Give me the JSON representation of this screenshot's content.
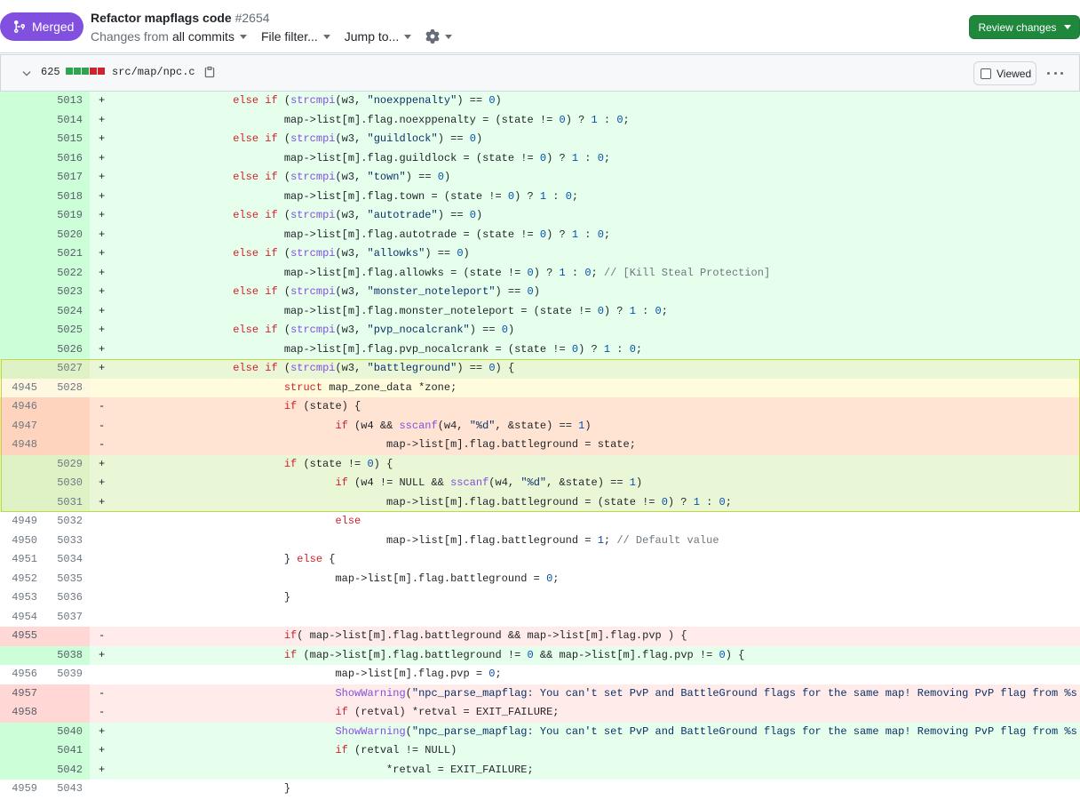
{
  "pr": {
    "state_label": "Merged",
    "title": "Refactor mapflags code",
    "number": "#2654",
    "changes_prefix": "Changes from",
    "changes_value": "all commits",
    "file_filter": "File filter...",
    "jump_to": "Jump to...",
    "review_button": "Review changes"
  },
  "file": {
    "change_count": "625",
    "path": "src/map/npc.c",
    "viewed_label": "Viewed",
    "diffstat": [
      "add",
      "add",
      "add",
      "del",
      "del"
    ]
  },
  "colors": {
    "merged": "#8250df",
    "review": "#1f883d",
    "add": "#e6ffec",
    "del": "#ffebe9"
  },
  "diff": [
    {
      "t": "add",
      "o": "",
      "n": "5013",
      "s": "+",
      "c": "\t\t\t\telse if (strcmpi(w3, \"noexppenalty\") == 0)"
    },
    {
      "t": "add",
      "o": "",
      "n": "5014",
      "s": "+",
      "c": "\t\t\t\t\t\tmap->list[m].flag.noexppenalty = (state != 0) ? 1 : 0;"
    },
    {
      "t": "add",
      "o": "",
      "n": "5015",
      "s": "+",
      "c": "\t\t\t\telse if (strcmpi(w3, \"guildlock\") == 0)"
    },
    {
      "t": "add",
      "o": "",
      "n": "5016",
      "s": "+",
      "c": "\t\t\t\t\t\tmap->list[m].flag.guildlock = (state != 0) ? 1 : 0;"
    },
    {
      "t": "add",
      "o": "",
      "n": "5017",
      "s": "+",
      "c": "\t\t\t\telse if (strcmpi(w3, \"town\") == 0)"
    },
    {
      "t": "add",
      "o": "",
      "n": "5018",
      "s": "+",
      "c": "\t\t\t\t\t\tmap->list[m].flag.town = (state != 0) ? 1 : 0;"
    },
    {
      "t": "add",
      "o": "",
      "n": "5019",
      "s": "+",
      "c": "\t\t\t\telse if (strcmpi(w3, \"autotrade\") == 0)"
    },
    {
      "t": "add",
      "o": "",
      "n": "5020",
      "s": "+",
      "c": "\t\t\t\t\t\tmap->list[m].flag.autotrade = (state != 0) ? 1 : 0;"
    },
    {
      "t": "add",
      "o": "",
      "n": "5021",
      "s": "+",
      "c": "\t\t\t\telse if (strcmpi(w3, \"allowks\") == 0)"
    },
    {
      "t": "add",
      "o": "",
      "n": "5022",
      "s": "+",
      "c": "\t\t\t\t\t\tmap->list[m].flag.allowks = (state != 0) ? 1 : 0; // [Kill Steal Protection]"
    },
    {
      "t": "add",
      "o": "",
      "n": "5023",
      "s": "+",
      "c": "\t\t\t\telse if (strcmpi(w3, \"monster_noteleport\") == 0)"
    },
    {
      "t": "add",
      "o": "",
      "n": "5024",
      "s": "+",
      "c": "\t\t\t\t\t\tmap->list[m].flag.monster_noteleport = (state != 0) ? 1 : 0;"
    },
    {
      "t": "add",
      "o": "",
      "n": "5025",
      "s": "+",
      "c": "\t\t\t\telse if (strcmpi(w3, \"pvp_nocalcrank\") == 0)"
    },
    {
      "t": "add",
      "o": "",
      "n": "5026",
      "s": "+",
      "c": "\t\t\t\t\t\tmap->list[m].flag.pvp_nocalcrank = (state != 0) ? 1 : 0;"
    },
    {
      "t": "sel-add",
      "o": "",
      "n": "5027",
      "s": "+",
      "c": "\t\t\t\telse if (strcmpi(w3, \"battleground\") == 0) {"
    },
    {
      "t": "sel-ctx",
      "o": "4945",
      "n": "5028",
      "s": "",
      "c": "\t\t\t\t\t\tstruct map_zone_data *zone;"
    },
    {
      "t": "sel-del",
      "o": "4946",
      "n": "",
      "s": "-",
      "c": "\t\t\t\t\t\tif (state) {"
    },
    {
      "t": "sel-del",
      "o": "4947",
      "n": "",
      "s": "-",
      "c": "\t\t\t\t\t\t\t\tif (w4 && sscanf(w4, \"%d\", &state) == 1)"
    },
    {
      "t": "sel-del",
      "o": "4948",
      "n": "",
      "s": "-",
      "c": "\t\t\t\t\t\t\t\t\t\tmap->list[m].flag.battleground = state;"
    },
    {
      "t": "sel-add",
      "o": "",
      "n": "5029",
      "s": "+",
      "c": "\t\t\t\t\t\tif (state != 0) {"
    },
    {
      "t": "sel-add",
      "o": "",
      "n": "5030",
      "s": "+",
      "c": "\t\t\t\t\t\t\t\tif (w4 != NULL && sscanf(w4, \"%d\", &state) == 1)"
    },
    {
      "t": "sel-add",
      "o": "",
      "n": "5031",
      "s": "+",
      "c": "\t\t\t\t\t\t\t\t\t\tmap->list[m].flag.battleground = (state != 0) ? 1 : 0;"
    },
    {
      "t": "ctx",
      "o": "4949",
      "n": "5032",
      "s": "",
      "c": "\t\t\t\t\t\t\t\telse"
    },
    {
      "t": "ctx",
      "o": "4950",
      "n": "5033",
      "s": "",
      "c": "\t\t\t\t\t\t\t\t\t\tmap->list[m].flag.battleground = 1; // Default value"
    },
    {
      "t": "ctx",
      "o": "4951",
      "n": "5034",
      "s": "",
      "c": "\t\t\t\t\t\t} else {"
    },
    {
      "t": "ctx",
      "o": "4952",
      "n": "5035",
      "s": "",
      "c": "\t\t\t\t\t\t\t\tmap->list[m].flag.battleground = 0;"
    },
    {
      "t": "ctx",
      "o": "4953",
      "n": "5036",
      "s": "",
      "c": "\t\t\t\t\t\t}"
    },
    {
      "t": "ctx",
      "o": "4954",
      "n": "5037",
      "s": "",
      "c": ""
    },
    {
      "t": "del",
      "o": "4955",
      "n": "",
      "s": "-",
      "c": "\t\t\t\t\t\tif( map->list[m].flag.battleground && map->list[m].flag.pvp ) {"
    },
    {
      "t": "add",
      "o": "",
      "n": "5038",
      "s": "+",
      "c": "\t\t\t\t\t\tif (map->list[m].flag.battleground != 0 && map->list[m].flag.pvp != 0) {"
    },
    {
      "t": "ctx",
      "o": "4956",
      "n": "5039",
      "s": "",
      "c": "\t\t\t\t\t\t\t\tmap->list[m].flag.pvp = 0;"
    },
    {
      "t": "del",
      "o": "4957",
      "n": "",
      "s": "-",
      "c": "\t\t\t\t\t\t\t\tShowWarning(\"npc_parse_mapflag: You can't set PvP and BattleGround flags for the same map! Removing PvP flag from %s in file '%s', line '%d'.\\n\", map->list[m].name, filepath, strline(buffer,start-buffer));"
    },
    {
      "t": "del",
      "o": "4958",
      "n": "",
      "s": "-",
      "c": "\t\t\t\t\t\t\t\tif (retval) *retval = EXIT_FAILURE;"
    },
    {
      "t": "add",
      "o": "",
      "n": "5040",
      "s": "+",
      "c": "\t\t\t\t\t\t\t\tShowWarning(\"npc_parse_mapflag: You can't set PvP and BattleGround flags for the same map! Removing PvP flag from %s in file '%s', line '%d'.\\n\", map->list[m].name, filepath, strline(buffer,start-buffer));"
    },
    {
      "t": "add",
      "o": "",
      "n": "5041",
      "s": "+",
      "c": "\t\t\t\t\t\t\t\tif (retval != NULL)"
    },
    {
      "t": "add",
      "o": "",
      "n": "5042",
      "s": "+",
      "c": "\t\t\t\t\t\t\t\t\t\t*retval = EXIT_FAILURE;"
    },
    {
      "t": "ctx",
      "o": "4959",
      "n": "5043",
      "s": "",
      "c": "\t\t\t\t\t\t}"
    }
  ]
}
